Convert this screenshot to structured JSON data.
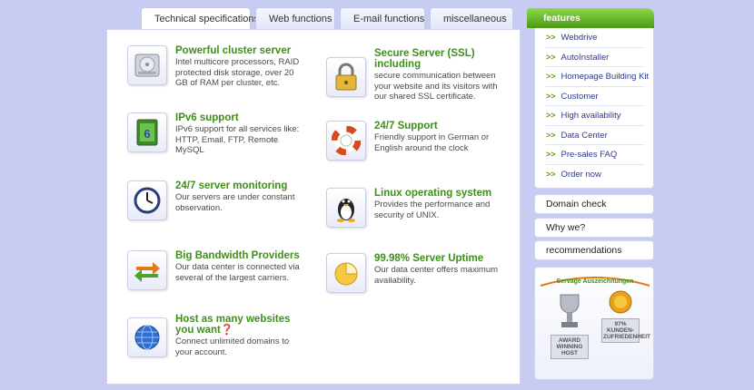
{
  "tabs": [
    {
      "label": "Technical specifications",
      "active": true
    },
    {
      "label": "Web functions",
      "active": false
    },
    {
      "label": "E-mail functions",
      "active": false
    },
    {
      "label": "miscellaneous",
      "active": false
    }
  ],
  "features_left": [
    {
      "title": "Powerful cluster server",
      "desc": "Intel multicore processors, RAID protected disk storage, over 20 GB of RAM per cluster, etc.",
      "icon": "hard-drive-icon"
    },
    {
      "title": "IPv6 support",
      "desc": "IPv6 support for all services like: HTTP, Email, FTP, Remote MySQL",
      "icon": "ipv6-icon"
    },
    {
      "title": "24/7 server monitoring",
      "desc": "Our servers are under constant observation.",
      "icon": "clock-icon"
    },
    {
      "title": "Big Bandwidth Providers",
      "desc": "Our data center is connected via several of the largest carriers.",
      "icon": "arrows-icon"
    },
    {
      "title": "Host as many websites you want❓",
      "desc": "Connect unlimited domains to your account.",
      "icon": "globe-icon"
    }
  ],
  "features_right": [
    {
      "title": "Secure Server (SSL) including",
      "desc": "secure communication between your website and its visitors with our shared SSL certificate.",
      "icon": "lock-icon"
    },
    {
      "title": "24/7 Support",
      "desc": "Friendly support in German or English around the clock",
      "icon": "lifebuoy-icon"
    },
    {
      "title": "Linux operating system",
      "desc": "Provides the performance and security of UNIX.",
      "icon": "tux-icon"
    },
    {
      "title": "99.98% Server Uptime",
      "desc": "Our data center offers maximum availability.",
      "icon": "pie-icon"
    }
  ],
  "sidebar": {
    "features_title": "features",
    "arrow": ">>",
    "feature_items": [
      "Webdrive",
      "AutoInstaller",
      "Homepage Building Kit",
      "Customer",
      "High availability",
      "Data Center",
      "Pre-sales FAQ",
      "Order now"
    ],
    "boxes": [
      "Domain check",
      "Why we?",
      "recommendations"
    ],
    "awards": {
      "title": "Servage Auszeichnungen",
      "badge1": "AWARD WINNING HOST",
      "badge2": "97% KUNDEN-ZUFRIEDENHEIT"
    }
  },
  "colors": {
    "accent_green": "#3f8f1a",
    "link_blue": "#2d3a8c",
    "background": "#c9ccf2"
  }
}
